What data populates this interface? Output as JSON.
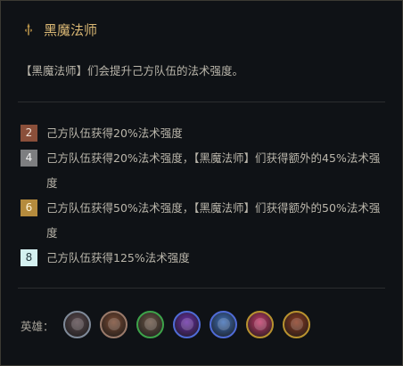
{
  "trait": {
    "icon": "wand-icon",
    "title": "黑魔法师",
    "description": "【黑魔法师】们会提升己方队伍的法术强度。"
  },
  "tiers": [
    {
      "count": "2",
      "rank": "bronze",
      "text": "己方队伍获得20%法术强度"
    },
    {
      "count": "4",
      "rank": "silver",
      "text": "己方队伍获得20%法术强度，【黑魔法师】们获得额外的45%法术强度"
    },
    {
      "count": "6",
      "rank": "gold",
      "text": "己方队伍获得50%法术强度，【黑魔法师】们获得额外的50%法术强度"
    },
    {
      "count": "8",
      "rank": "platinum",
      "text": "己方队伍获得125%法术强度"
    }
  ],
  "champions": {
    "label": "英雄：",
    "portraits": [
      {
        "icon": "champion-portrait-1",
        "border": "#7f8a99",
        "fill": "#5a4a4f"
      },
      {
        "icon": "champion-portrait-2",
        "border": "#9a7a6a",
        "fill": "#7a4a32"
      },
      {
        "icon": "champion-portrait-3",
        "border": "#3da34a",
        "fill": "#6a5545"
      },
      {
        "icon": "champion-portrait-4",
        "border": "#4f6bd6",
        "fill": "#6a2fa8"
      },
      {
        "icon": "champion-portrait-5",
        "border": "#4f6bd6",
        "fill": "#3f6fb8"
      },
      {
        "icon": "champion-portrait-6",
        "border": "#b8922f",
        "fill": "#c23a6a"
      },
      {
        "icon": "champion-portrait-7",
        "border": "#b8922f",
        "fill": "#8a3a20"
      }
    ]
  },
  "colors": {
    "title": "#d9b774",
    "text": "#b9b5aa",
    "background": "#0f1216"
  }
}
